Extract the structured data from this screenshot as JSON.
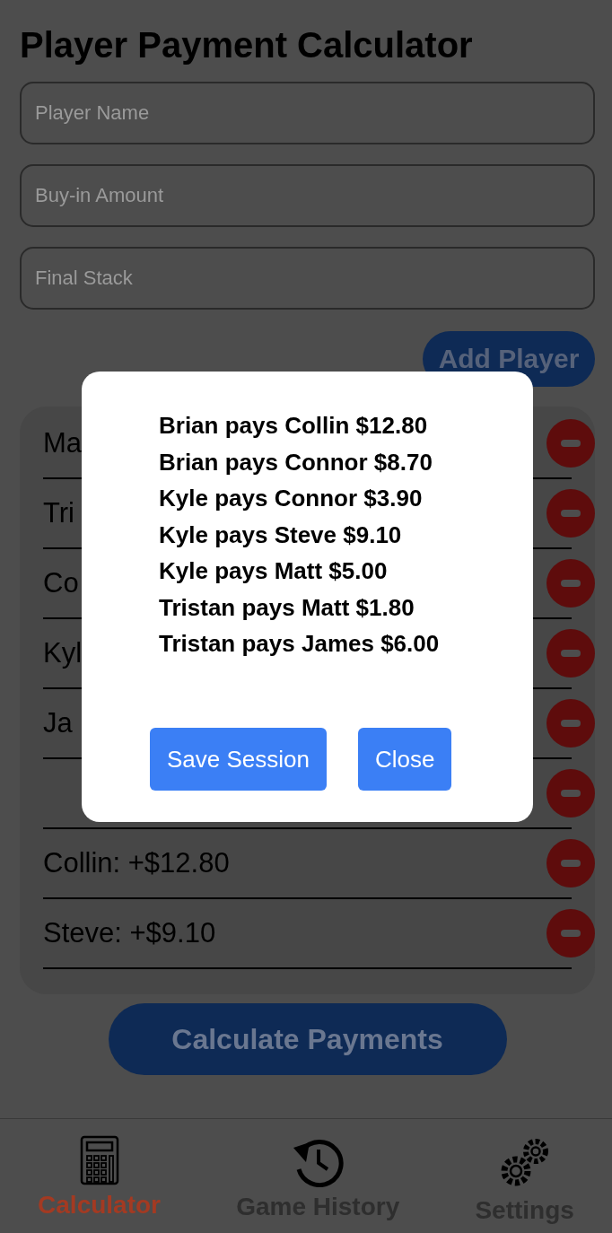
{
  "title": "Player Payment Calculator",
  "fields": [
    {
      "placeholder": "Player Name"
    },
    {
      "placeholder": "Buy-in Amount"
    },
    {
      "placeholder": "Final Stack"
    }
  ],
  "add_button": "Add Player",
  "players": [
    {
      "kind": "entry",
      "label": "Ma"
    },
    {
      "kind": "entry",
      "label": "Tri"
    },
    {
      "kind": "entry",
      "label": "Co"
    },
    {
      "kind": "entry",
      "label": "Kyl"
    },
    {
      "kind": "entry",
      "label": "Ja"
    },
    {
      "kind": "covered"
    },
    {
      "kind": "entry",
      "label": "Collin: +$12.80"
    },
    {
      "kind": "entry",
      "label": "Steve: +$9.10"
    }
  ],
  "calculate_button": "Calculate Payments",
  "dialog": {
    "lines": [
      "Brian pays Collin $12.80",
      "Brian pays Connor $8.70",
      "Kyle pays Connor $3.90",
      "Kyle pays Steve $9.10",
      "Kyle pays Matt $5.00",
      "Tristan pays Matt $1.80",
      "Tristan pays James $6.00"
    ],
    "buttons": [
      "Save Session",
      "Close"
    ]
  },
  "tabs": [
    {
      "label": "Calculator",
      "kind": "calculator",
      "selected": true
    },
    {
      "label": "Game History",
      "kind": "history",
      "selected": false
    },
    {
      "label": "Settings",
      "kind": "settings",
      "selected": false
    }
  ]
}
